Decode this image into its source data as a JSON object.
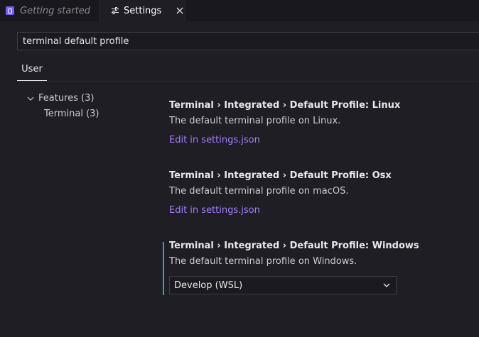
{
  "tabs": [
    {
      "label": "Getting started",
      "icon": "app-icon",
      "active": false
    },
    {
      "label": "Settings",
      "icon": "settings-sliders-icon",
      "active": true,
      "close_icon": "close-icon"
    }
  ],
  "search": {
    "value": "terminal default profile"
  },
  "scope_tabs": [
    {
      "label": "User",
      "active": true
    }
  ],
  "toc": {
    "group": {
      "label": "Features (3)",
      "icon": "chevron-down-icon"
    },
    "items": [
      {
        "label": "Terminal (3)"
      }
    ]
  },
  "settings": [
    {
      "title": "Terminal › Integrated › Default Profile: Linux",
      "description": "The default terminal profile on Linux.",
      "link": "Edit in settings.json"
    },
    {
      "title": "Terminal › Integrated › Default Profile: Osx",
      "description": "The default terminal profile on macOS.",
      "link": "Edit in settings.json"
    },
    {
      "title": "Terminal › Integrated › Default Profile: Windows",
      "description": "The default terminal profile on Windows.",
      "select_value": "Develop (WSL)",
      "select_icon": "chevron-down-icon",
      "focused": true
    }
  ],
  "colors": {
    "background": "#1f1e25",
    "link": "#a47df7",
    "focus_indicator": "#2fa3c4",
    "app_icon": "#7a5cff"
  }
}
